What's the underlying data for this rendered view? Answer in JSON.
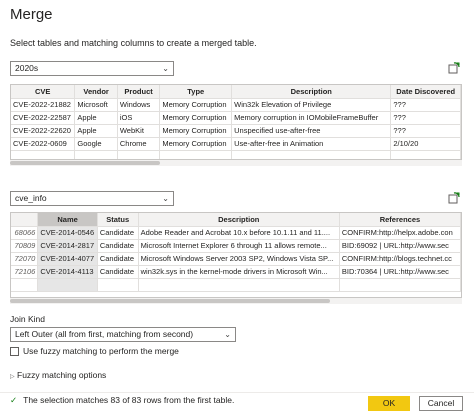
{
  "dialog": {
    "title": "Merge",
    "subtitle": "Select tables and matching columns to create a merged table."
  },
  "first_table": {
    "selected": "2020s",
    "columns": [
      "CVE",
      "Vendor",
      "Product",
      "Type",
      "Description",
      "Date Discovered"
    ],
    "rows": [
      [
        "CVE-2022-21882",
        "Microsoft",
        "Windows",
        "Memory Corruption",
        "Win32k Elevation of Privilege",
        "???"
      ],
      [
        "CVE-2022-22587",
        "Apple",
        "iOS",
        "Memory Corruption",
        "Memory corruption in IOMobileFrameBuffer",
        "???"
      ],
      [
        "CVE-2022-22620",
        "Apple",
        "WebKit",
        "Memory Corruption",
        "Unspecified use-after-free",
        "???"
      ],
      [
        "CVE-2022-0609",
        "Google",
        "Chrome",
        "Memory Corruption",
        "Use-after-free in Animation",
        "2/10/20"
      ]
    ]
  },
  "second_table": {
    "selected": "cve_info",
    "columns": [
      "",
      "Name",
      "Status",
      "Description",
      "References"
    ],
    "rows": [
      [
        "68066",
        "CVE-2014-0546",
        "Candidate",
        "Adobe Reader and Acrobat 10.x before 10.1.11 and 11....",
        "CONFIRM:http://helpx.adobe.con"
      ],
      [
        "70809",
        "CVE-2014-2817",
        "Candidate",
        "Microsoft Internet Explorer 6 through 11 allows remote...",
        "BID:69092 | URL:http://www.sec"
      ],
      [
        "72070",
        "CVE-2014-4077",
        "Candidate",
        "Microsoft Windows Server 2003 SP2, Windows Vista SP...",
        "CONFIRM:http://blogs.technet.cc"
      ],
      [
        "72106",
        "CVE-2014-4113",
        "Candidate",
        "win32k.sys in the kernel-mode drivers in Microsoft Win...",
        "BID:70364 | URL:http://www.sec"
      ]
    ]
  },
  "join": {
    "label": "Join Kind",
    "selected": "Left Outer (all from first, matching from second)"
  },
  "fuzzy": {
    "checkbox_label": "Use fuzzy matching to perform the merge",
    "options_label": "Fuzzy matching options"
  },
  "status": {
    "message": "The selection matches 83 of 83 rows from the first table."
  },
  "buttons": {
    "ok": "OK",
    "cancel": "Cancel"
  },
  "colors": {
    "accent": "#f2c811",
    "success": "#107c10"
  },
  "icons": {
    "refresh": "refresh-icon",
    "chevron": "chevron-down-icon",
    "check": "check-icon",
    "expand": "triangle-right-icon"
  }
}
